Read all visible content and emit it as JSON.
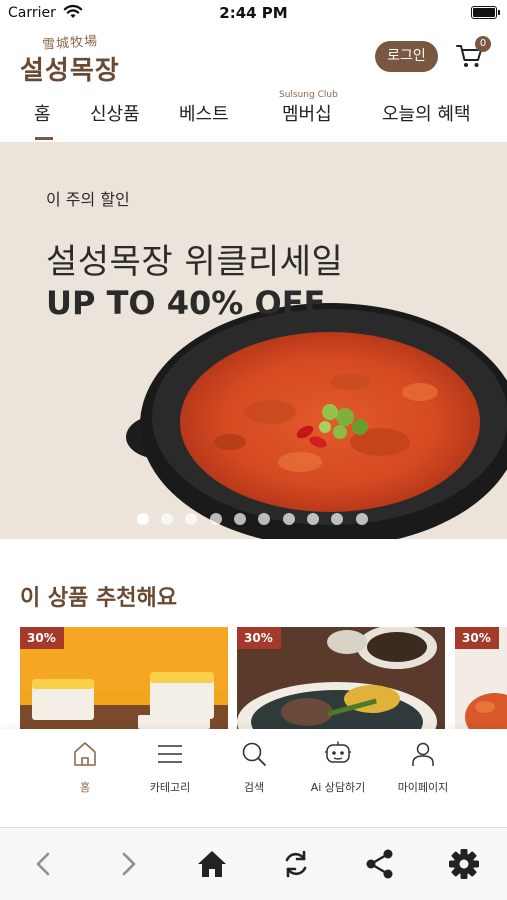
{
  "status_bar": {
    "carrier": "Carrier",
    "time": "2:44 PM"
  },
  "header": {
    "logo_hanja": "雪城牧場",
    "logo_text": "설성목장",
    "login_label": "로그인",
    "cart_count": "0"
  },
  "nav": {
    "tabs": [
      {
        "label": "홈",
        "active": true
      },
      {
        "label": "신상품"
      },
      {
        "label": "베스트"
      },
      {
        "label": "멤버십",
        "sub": "Sulsung Club"
      },
      {
        "label": "오늘의 혜택"
      }
    ]
  },
  "hero": {
    "subtitle": "이 주의 할인",
    "title": "설성목장 위클리세일",
    "offer": "UP TO 40% OFF",
    "slide_count": 10,
    "active_slide": 0
  },
  "recommend": {
    "title": "이 상품 추천해요",
    "products": [
      {
        "badge": "30%"
      },
      {
        "badge": "30%"
      },
      {
        "badge": "30%"
      }
    ]
  },
  "bottom_menu": {
    "items": [
      {
        "label": "홈",
        "icon": "home-outline-icon"
      },
      {
        "label": "카테고리",
        "icon": "menu-lines-icon"
      },
      {
        "label": "검색",
        "icon": "search-icon"
      },
      {
        "label": "Ai 상담하기",
        "icon": "ai-chat-icon"
      },
      {
        "label": "마이페이지",
        "icon": "person-icon"
      }
    ]
  },
  "toolbar": {
    "icons": [
      "back-icon",
      "forward-icon",
      "home-icon",
      "refresh-icon",
      "share-icon",
      "settings-icon"
    ]
  },
  "colors": {
    "brand_brown": "#7a5740",
    "badge_red": "#a33a2a",
    "hero_bg": "#ece4da"
  }
}
